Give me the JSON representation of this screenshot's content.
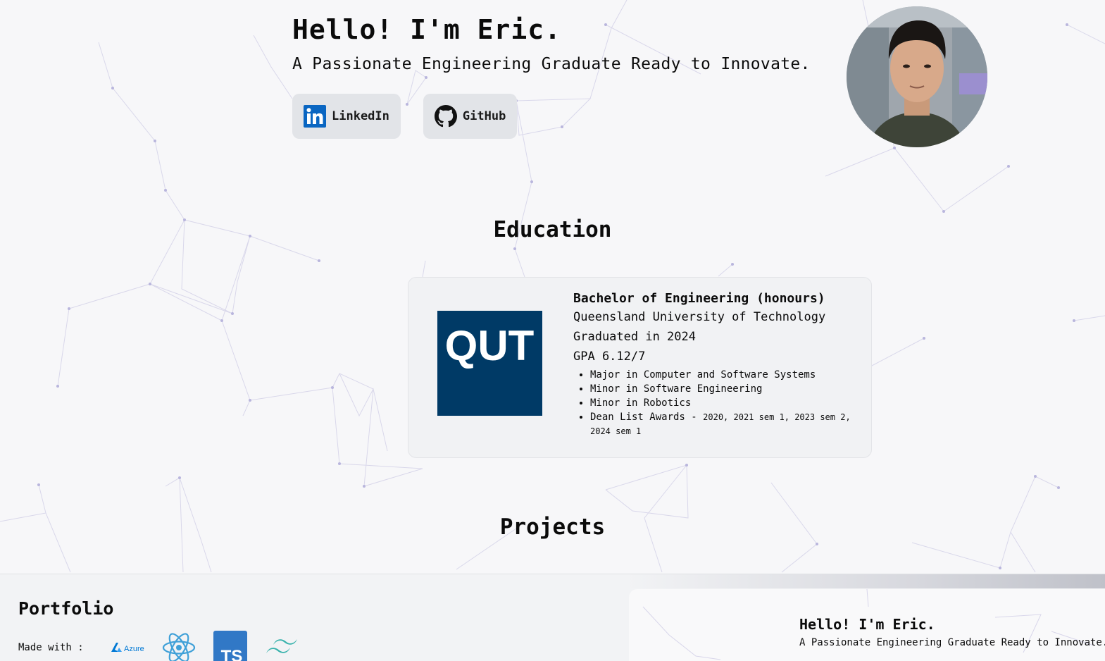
{
  "hero": {
    "title": "Hello! I'm Eric.",
    "subtitle": "A Passionate Engineering Graduate Ready to Innovate."
  },
  "social": {
    "linkedin_label": "LinkedIn",
    "github_label": "GitHub"
  },
  "avatar": {
    "icon": "profile-photo"
  },
  "education": {
    "section_title": "Education",
    "degree": "Bachelor of Engineering (honours)",
    "university": "Queensland University of Technology",
    "logo_text": "QUT",
    "graduated": "Graduated in 2024",
    "gpa": "GPA 6.12/7",
    "items": [
      "Major in Computer and Software Systems",
      "Minor in Software Engineering",
      "Minor in Robotics"
    ],
    "dean_list_label": "Dean List Awards - ",
    "dean_list_years": "2020, 2021 sem 1, 2023 sem 2, 2024 sem 1"
  },
  "projects": {
    "section_title": "Projects"
  },
  "footer": {
    "title": "Portfolio",
    "made_with_label": "Made with :",
    "tech": [
      "Azure",
      "React",
      "TS",
      "Tailwind CSS"
    ],
    "azure_text": "Azure",
    "ts_text": "TS",
    "preview_title": "Hello! I'm Eric.",
    "preview_subtitle": "A Passionate Engineering Graduate Ready to Innovate."
  },
  "colors": {
    "background": "#f7f7f9",
    "card": "#f1f2f4",
    "button": "#e2e4e8",
    "linkedin": "#0a66c2",
    "qut_blue": "#003a66",
    "react": "#3fa0d8",
    "typescript": "#3178c6",
    "tailwind": "#38b2ac",
    "network_lines": "#c9c7e3"
  }
}
